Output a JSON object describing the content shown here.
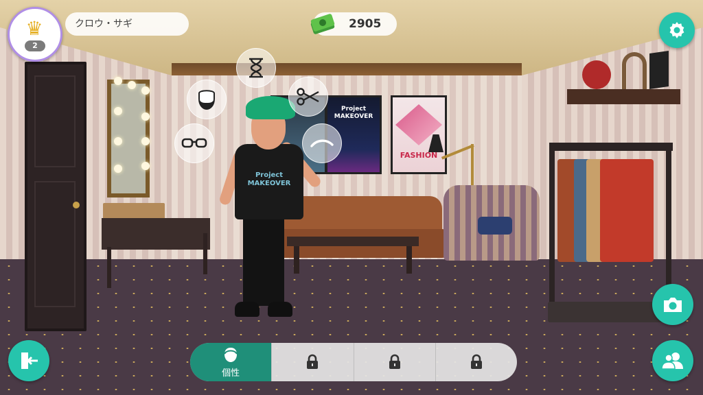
{
  "player": {
    "level": "2",
    "name": "クロウ・サギ",
    "crown_icon": "crown-icon"
  },
  "currency": {
    "amount": "2905",
    "icon": "cash-stack-icon"
  },
  "scene": {
    "poster_logo_text": "Project MAKEOVER",
    "poster_fashion_text": "FASHION",
    "shirt_text": "Project MAKEOVER"
  },
  "customize_bubbles": [
    {
      "name": "time-bubble",
      "icon": "hourglass-icon"
    },
    {
      "name": "beard-bubble",
      "icon": "beard-icon"
    },
    {
      "name": "scissors-bubble",
      "icon": "scissors-icon"
    },
    {
      "name": "glasses-bubble",
      "icon": "glasses-icon"
    },
    {
      "name": "eyebrow-bubble",
      "icon": "eyebrow-icon"
    }
  ],
  "bottom_tabs": [
    {
      "label": "個性",
      "icon": "person-icon",
      "active": true
    },
    {
      "label": "",
      "icon": "lock-icon",
      "active": false
    },
    {
      "label": "",
      "icon": "lock-icon",
      "active": false
    },
    {
      "label": "",
      "icon": "lock-icon",
      "active": false
    }
  ],
  "colors": {
    "accent_teal": "#26c4ac",
    "active_tab": "#1f8f79",
    "avatar_ring": "#b08ee6"
  }
}
